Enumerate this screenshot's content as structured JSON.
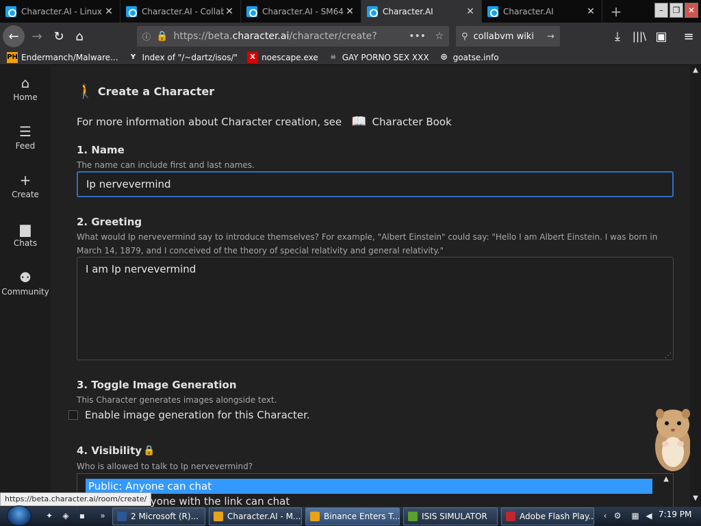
{
  "browser": {
    "tabs": [
      {
        "label": "Character.AI - Linux",
        "active": false
      },
      {
        "label": "Character.AI - Collab",
        "active": false
      },
      {
        "label": "Character.AI - SM64",
        "active": false
      },
      {
        "label": "Character.AI",
        "active": true
      },
      {
        "label": "Character.AI",
        "active": false
      }
    ],
    "url_prefix": "https://beta.",
    "url_host": "character.ai",
    "url_path": "/character/create?",
    "search_text": "collabvm wiki",
    "bookmarks": [
      {
        "label": "Endermanch/Malware...",
        "icon": "PH"
      },
      {
        "label": "Index of \"/~dartz/isos/\"",
        "icon": "Y"
      },
      {
        "label": "noescape.exe",
        "icon": "X"
      },
      {
        "label": "GAY PORNO SEX XXX",
        "icon": "skull"
      },
      {
        "label": "goatse.info",
        "icon": "globe"
      }
    ]
  },
  "sidebar": {
    "items": [
      {
        "label": "Home",
        "icon": "home-icon"
      },
      {
        "label": "Feed",
        "icon": "feed-icon"
      },
      {
        "label": "Create",
        "icon": "plus-icon"
      },
      {
        "label": "Chats",
        "icon": "chat-icon"
      },
      {
        "label": "Community",
        "icon": "people-icon"
      }
    ]
  },
  "form": {
    "title": "Create a Character",
    "more_info": "For more information about Character creation, see",
    "book_link": "Character Book",
    "name": {
      "heading": "1. Name",
      "sub": "The name can include first and last names.",
      "value": "Ip nervevermind"
    },
    "greeting": {
      "heading": "2. Greeting",
      "sub": "What would Ip nervevermind say to introduce themselves? For example, \"Albert Einstein\" could say: \"Hello I am Albert Einstein. I was born in March 14, 1879, and I conceived of the theory of special relativity and general relativity.\"",
      "value": "I am Ip nervevermind"
    },
    "image_gen": {
      "heading": "3. Toggle Image Generation",
      "sub": "This Character generates images alongside text.",
      "checkbox_label": "Enable image generation for this Character.",
      "checked": false
    },
    "visibility": {
      "heading": "4. Visibility",
      "sub": "Who is allowed to talk to Ip nervevermind?",
      "options": [
        "Public: Anyone can chat",
        "Unlisted: Anyone with the link can chat"
      ],
      "selected": "Public: Anyone can chat"
    }
  },
  "status_url": "https://beta.character.ai/room/create/",
  "taskbar": {
    "buttons": [
      {
        "label": "2 Microsoft (R)...",
        "color": "#2b5797"
      },
      {
        "label": "Character.AI - M...",
        "color": "#e8a317"
      },
      {
        "label": "Binance Enters T...",
        "color": "#e8a317"
      },
      {
        "label": "ISIS SIMULATOR",
        "color": "#5aa02c"
      },
      {
        "label": "Adobe Flash Play...",
        "color": "#c0262d"
      }
    ],
    "clock": "7:19 PM"
  },
  "colors": {
    "accent": "#3399ff",
    "focus_border": "#2f70c0",
    "page_bg": "#212121"
  }
}
